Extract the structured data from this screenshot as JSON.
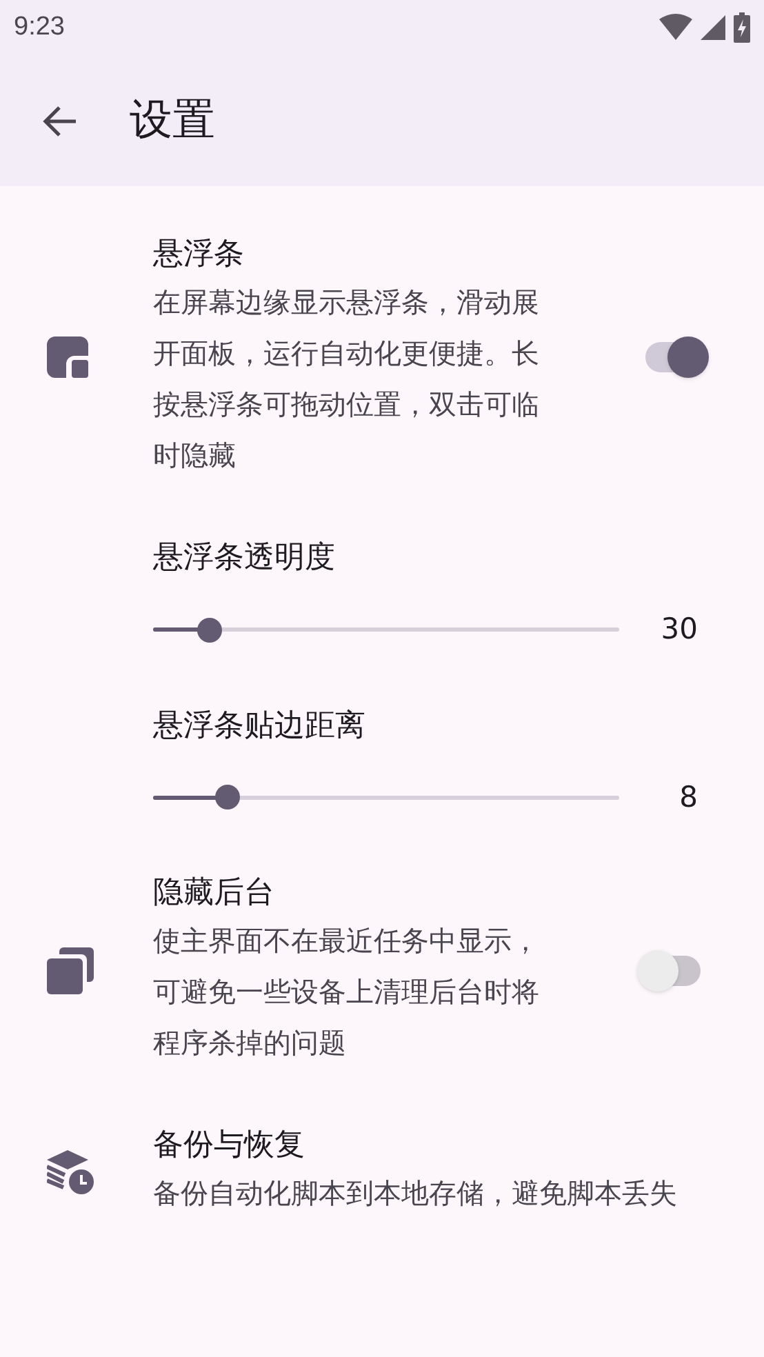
{
  "status_bar": {
    "time": "9:23"
  },
  "app_bar": {
    "title": "设置"
  },
  "settings": [
    {
      "kind": "toggle",
      "title": "悬浮条",
      "description": "在屏幕边缘显示悬浮条，滑动展开面板，运行自动化更便捷。长按悬浮条可拖动位置，双击可临时隐藏",
      "on": true
    },
    {
      "kind": "slider",
      "title": "悬浮条透明度",
      "level": 0.12,
      "reading": "30"
    },
    {
      "kind": "slider",
      "title": "悬浮条贴边距离",
      "level": 0.16,
      "reading": "8"
    },
    {
      "kind": "toggle",
      "title": "隐藏后台",
      "description": "使主界面不在最近任务中显示，可避免一些设备上清理后台时将程序杀掉的问题",
      "on": false
    },
    {
      "kind": "action",
      "title": "备份与恢复",
      "description": "备份自动化脚本到本地存储，避免脚本丢失"
    }
  ]
}
